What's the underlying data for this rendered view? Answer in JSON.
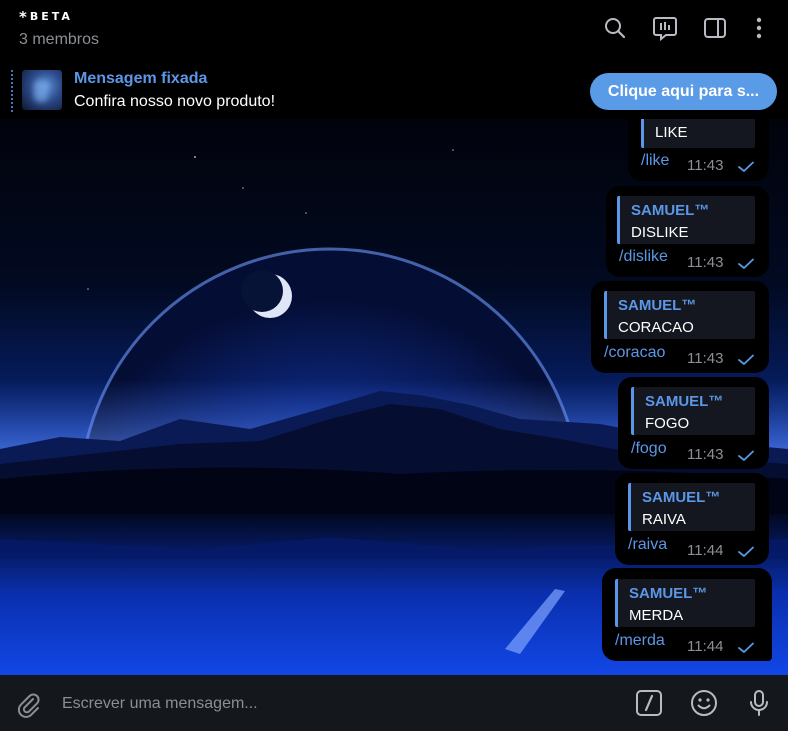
{
  "header": {
    "title_star": "*",
    "title": "BETA",
    "subtitle": "3 membros",
    "icons": [
      "search-icon",
      "poll-icon",
      "sidebar-icon",
      "more-icon"
    ]
  },
  "pinned": {
    "title": "Mensagem fixada",
    "text": "Confira nosso novo produto!",
    "button_label": "Clique aqui para s..."
  },
  "messages": [
    {
      "author": "",
      "quote": "LIKE",
      "command": "/like",
      "time": "11:43"
    },
    {
      "author": "SAMUEL™",
      "quote": "DISLIKE",
      "command": "/dislike",
      "time": "11:43"
    },
    {
      "author": "SAMUEL™",
      "quote": "CORACAO",
      "command": "/coracao",
      "time": "11:43"
    },
    {
      "author": "SAMUEL™",
      "quote": "FOGO",
      "command": "/fogo",
      "time": "11:43"
    },
    {
      "author": "SAMUEL™",
      "quote": "RAIVA",
      "command": "/raiva",
      "time": "11:44"
    },
    {
      "author": "SAMUEL™",
      "quote": "MERDA",
      "command": "/merda",
      "time": "11:44"
    }
  ],
  "composer": {
    "placeholder": "Escrever uma mensagem...",
    "value": "",
    "icons": [
      "attach-icon",
      "bot-command-icon",
      "emoji-icon",
      "microphone-icon"
    ]
  },
  "colors": {
    "accent": "#5b97e6",
    "button": "#5a9be8",
    "bubble": "#000000",
    "muted": "#8b8f95"
  }
}
